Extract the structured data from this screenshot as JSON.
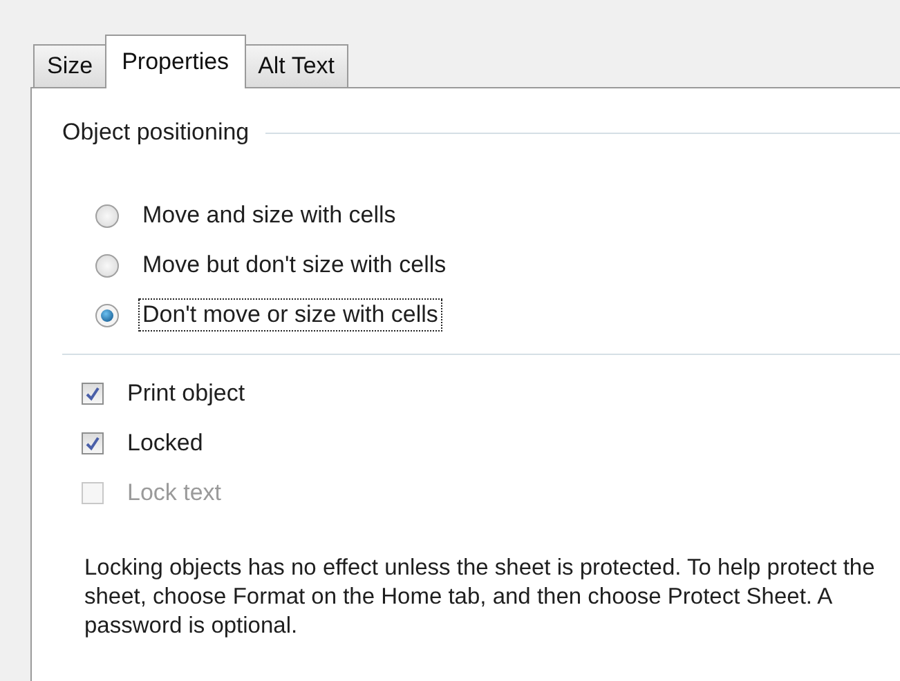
{
  "tabs": [
    {
      "label": "Size",
      "selected": false
    },
    {
      "label": "Properties",
      "selected": true
    },
    {
      "label": "Alt Text",
      "selected": false
    }
  ],
  "positioning": {
    "title": "Object positioning",
    "options": [
      {
        "label": "Move and size with cells",
        "selected": false,
        "focused": false
      },
      {
        "label": "Move but don't size with cells",
        "selected": false,
        "focused": false
      },
      {
        "label": "Don't move or size with cells",
        "selected": true,
        "focused": true
      }
    ]
  },
  "checkboxes": [
    {
      "label": "Print object",
      "checked": true,
      "disabled": false
    },
    {
      "label": "Locked",
      "checked": true,
      "disabled": false
    },
    {
      "label": "Lock text",
      "checked": false,
      "disabled": true
    }
  ],
  "note": "Locking objects has no effect unless the sheet is protected. To help protect the sheet, choose Format on the Home tab, and then choose Protect Sheet. A password is optional."
}
